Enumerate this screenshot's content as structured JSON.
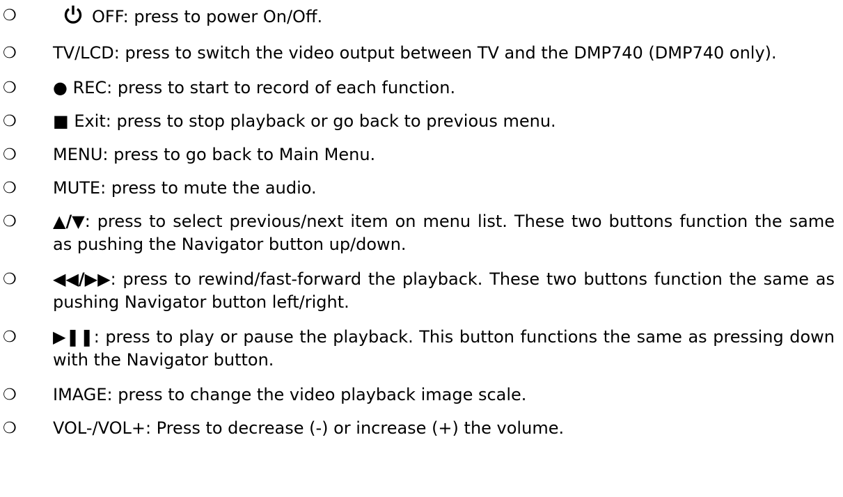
{
  "bullet_glyph": "❍",
  "items": [
    {
      "symbol_icon": "power-icon",
      "symbol": "",
      "text": "OFF: press to power On/Off."
    },
    {
      "symbol": "",
      "text": "TV/LCD: press to switch the video output between TV and the DMP740 (DMP740 only)."
    },
    {
      "symbol": "●",
      "text": " REC: press to start to record of each function."
    },
    {
      "symbol": "■",
      "text": " Exit: press to stop playback or go back to previous menu."
    },
    {
      "symbol": "",
      "text": "MENU: press to go back to Main Menu."
    },
    {
      "symbol": "",
      "text": "MUTE: press to mute the audio."
    },
    {
      "symbol": "▲/▼",
      "text": ": press to select previous/next item on menu list. These two buttons function the same as pushing the Navigator button up/down."
    },
    {
      "symbol": "◀◀/▶▶",
      "text": ": press to rewind/fast-forward the playback. These two buttons function the same as pushing Navigator button left/right."
    },
    {
      "symbol": "▶❚❚",
      "text": ": press to play or pause the playback. This button functions the same as pressing down with the Navigator button."
    },
    {
      "symbol": "",
      "text": "IMAGE: press to change the video playback image scale."
    },
    {
      "symbol": "",
      "text": "VOL-/VOL+: Press to decrease (-) or increase (+) the volume."
    }
  ]
}
